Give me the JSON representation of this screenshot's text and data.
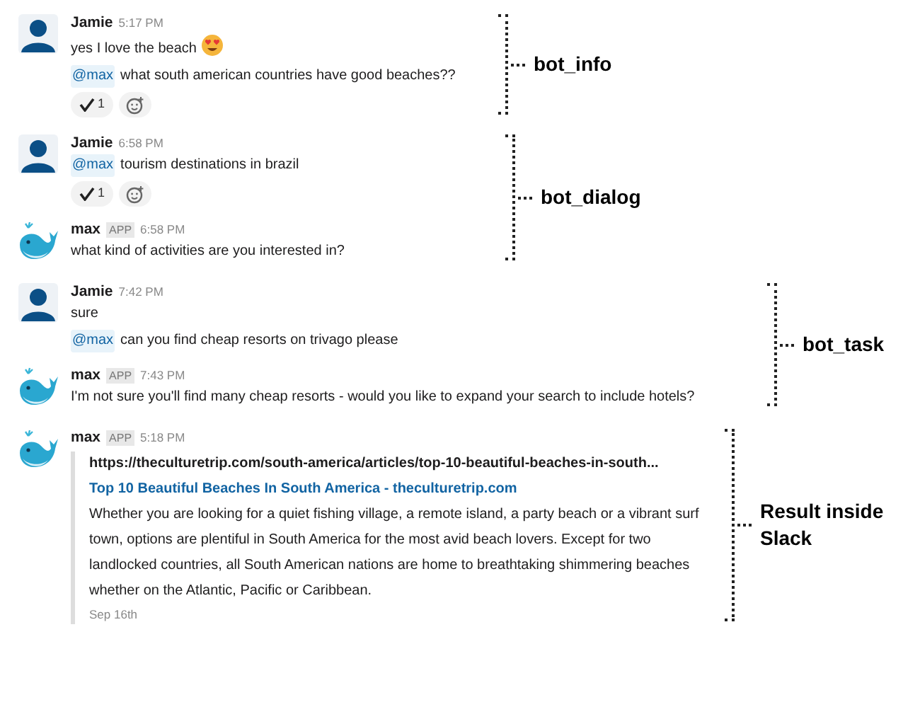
{
  "groups": [
    {
      "annotation": "bot_info",
      "messages": [
        {
          "kind": "user",
          "author": "Jamie",
          "time": "5:17 PM",
          "lines": [
            {
              "text": "yes I love the beach",
              "emoji": true
            },
            {
              "mention": "@max",
              "text": "what south american countries have good beaches??"
            }
          ],
          "reactions": [
            {
              "count": "1"
            }
          ],
          "add_reaction": true
        }
      ]
    },
    {
      "annotation": "bot_dialog",
      "messages": [
        {
          "kind": "user",
          "author": "Jamie",
          "time": "6:58 PM",
          "lines": [
            {
              "mention": "@max",
              "text": "tourism destinations in brazil"
            }
          ],
          "reactions": [
            {
              "count": "1"
            }
          ],
          "add_reaction": true
        },
        {
          "kind": "bot",
          "author": "max",
          "badge": "APP",
          "time": "6:58 PM",
          "lines": [
            {
              "text": "what kind of activities are you interested in?"
            }
          ]
        }
      ]
    },
    {
      "annotation": "bot_task",
      "messages": [
        {
          "kind": "user",
          "author": "Jamie",
          "time": "7:42 PM",
          "lines": [
            {
              "text": "sure"
            },
            {
              "mention": "@max",
              "text": "can you find cheap resorts on trivago please"
            }
          ]
        },
        {
          "kind": "bot",
          "author": "max",
          "badge": "APP",
          "time": "7:43 PM",
          "lines": [
            {
              "text": "I'm not sure you'll find many cheap resorts - would you like to expand your search to include hotels?"
            }
          ]
        }
      ]
    },
    {
      "annotation": "Result inside Slack",
      "messages": [
        {
          "kind": "bot",
          "author": "max",
          "badge": "APP",
          "time": "5:18 PM",
          "preview": {
            "url": "https://theculturetrip.com/south-america/articles/top-10-beautiful-beaches-in-south...",
            "title": "Top 10 Beautiful Beaches In South America - theculturetrip.com",
            "description": "Whether you are looking for a quiet fishing village, a remote island, a party beach or a vibrant surf town, options are plentiful in South America for the most avid beach lovers. Except for two landlocked countries, all South American nations are home to breathtaking shimmering beaches whether on the Atlantic, Pacific or Caribbean.",
            "date": "Sep 16th"
          }
        }
      ]
    }
  ]
}
